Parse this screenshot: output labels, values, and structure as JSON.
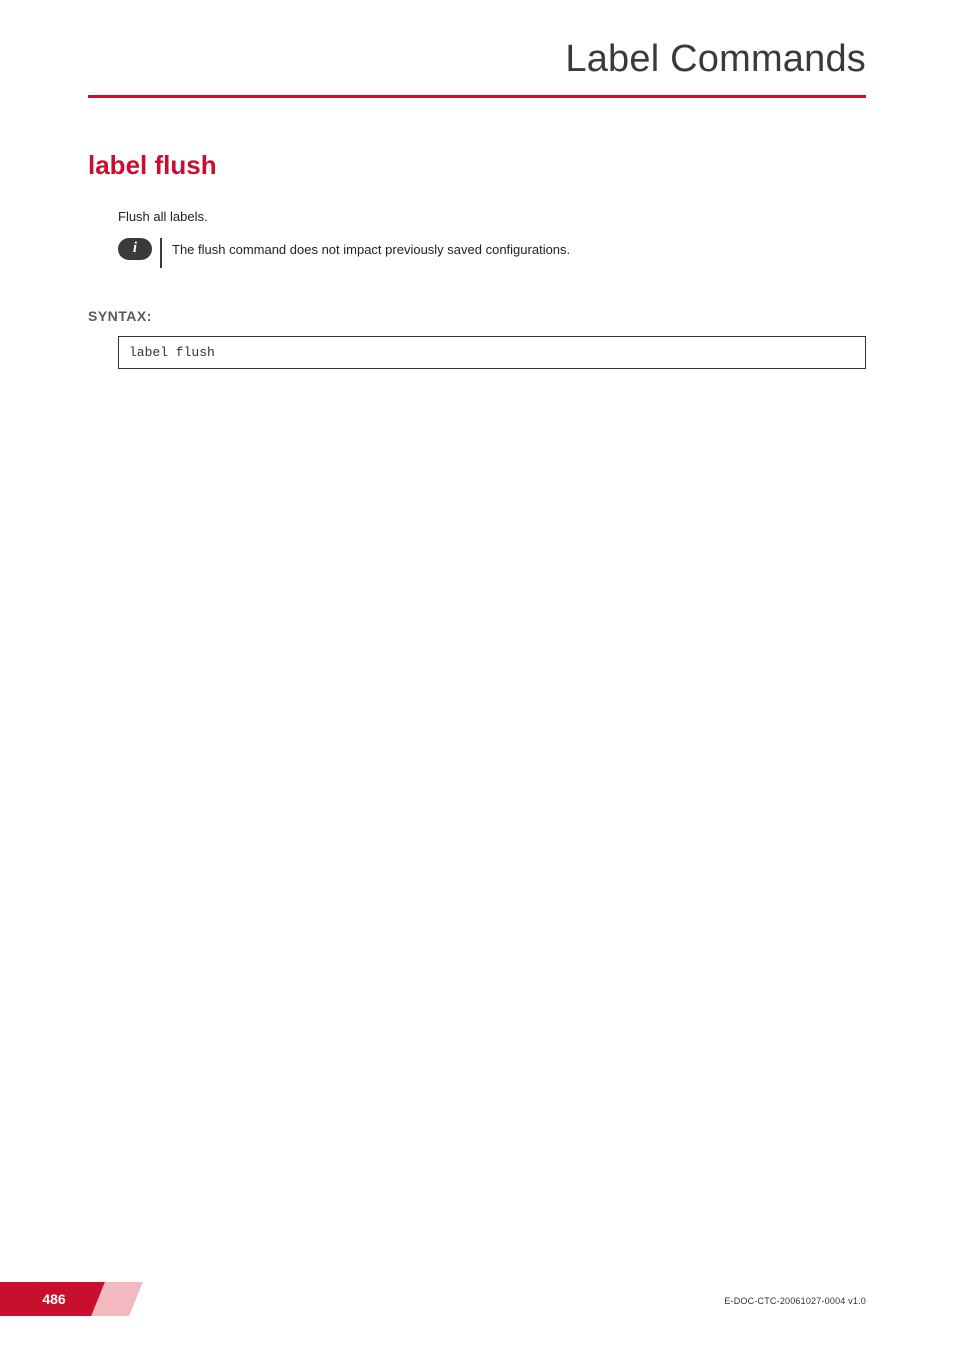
{
  "header": {
    "chapter_title": "Label Commands"
  },
  "command": {
    "title": "label flush",
    "intro": "Flush all labels.",
    "note": "The flush command does not impact previously saved configurations."
  },
  "syntax": {
    "heading": "SYNTAX:",
    "code": "label flush"
  },
  "footer": {
    "page_number": "486",
    "doc_id": "E-DOC-CTC-20061027-0004 v1.0"
  }
}
